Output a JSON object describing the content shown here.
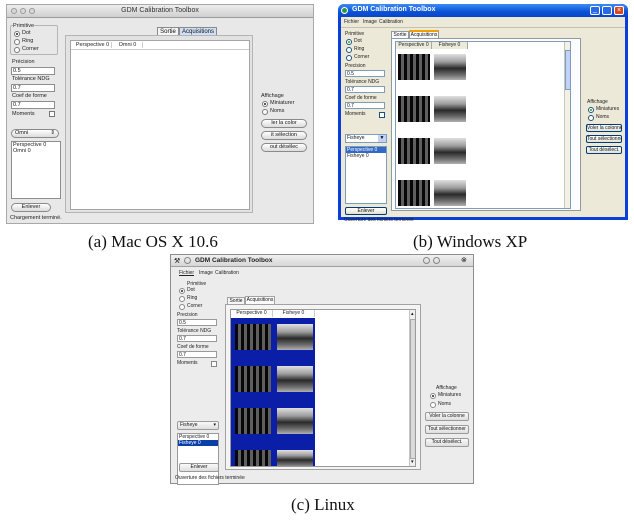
{
  "mac": {
    "title": "GDM Calibration Toolbox",
    "primitive_label": "Primitive",
    "primitives": [
      "Dot",
      "Ring",
      "Corner"
    ],
    "precision_label": "Précision",
    "precision_value": "0.5",
    "tolerance_label": "Tolérance NDG",
    "tolerance_value": "0.7",
    "form_label": "Coef de forme",
    "form_value": "0.7",
    "moments_label": "Moments",
    "camera_select": "Omni",
    "camera_list": [
      "Perspective 0",
      "Omni 0"
    ],
    "tabs": [
      "Sortie",
      "Acquisitions"
    ],
    "columns": [
      "Perspective 0",
      "Omni 0"
    ],
    "affichage_label": "Affichage",
    "display_options": [
      "Miniaturer",
      "Noms"
    ],
    "buttons": [
      "ler la color",
      "it sélection",
      "out désélec"
    ],
    "remove_button": "Enlever",
    "status": "Chargement terminé."
  },
  "xp": {
    "title": "GDM Calibration Toolbox",
    "menu": [
      "Fichier",
      "Image",
      "Calibration"
    ],
    "primitive_label": "Primitive",
    "primitives": [
      "Dot",
      "Ring",
      "Corner"
    ],
    "precision_label": "Precision",
    "precision_value": "0.5",
    "tolerance_label": "Tolérance NDG",
    "tolerance_value": "0.7",
    "form_label": "Coef de forme",
    "form_value": "0.7",
    "moments_label": "Moments",
    "camera_select": "Fisheye",
    "camera_list": [
      "Perspective 0",
      "Fisheye 0"
    ],
    "tabs": [
      "Sortie",
      "Acquisitions"
    ],
    "columns": [
      "Perspective 0",
      "Fisheye 0"
    ],
    "affichage_label": "Affichage",
    "display_options": [
      "Miniatures",
      "Noms"
    ],
    "buttons": [
      "Voler la colonne",
      "Tout sélectionner",
      "Tout désélect."
    ],
    "remove_button": "Enlever",
    "status": "Ouverture des fichiers terminée"
  },
  "linux": {
    "title": "GDM Calibration Toolbox",
    "menu": [
      "Fichier",
      "Image",
      "Calibration"
    ],
    "primitive_label": "Primitive",
    "primitives": [
      "Dot",
      "Ring",
      "Corner"
    ],
    "precision_label": "Precision",
    "precision_value": "0.5",
    "tolerance_label": "Tolérance NDG",
    "tolerance_value": "0.7",
    "form_label": "Coef de forme",
    "form_value": "0.7",
    "moments_label": "Moments",
    "camera_select": "Fisheye",
    "camera_list": [
      "Perspective 0",
      "Fisheye 0"
    ],
    "tabs": [
      "Sortie",
      "Acquisitions"
    ],
    "columns": [
      "Perspective 0",
      "Fisheye 0"
    ],
    "affichage_label": "Affichage",
    "display_options": [
      "Miniatures",
      "Noms"
    ],
    "buttons": [
      "Voler la colonne",
      "Tout sélectionner",
      "Tout désélect."
    ],
    "remove_button": "Enlever",
    "status": "Ouverture des fichiers terminée"
  },
  "captions": [
    "(a) Mac OS X 10.6",
    "(b) Windows XP",
    "(c) Linux"
  ]
}
